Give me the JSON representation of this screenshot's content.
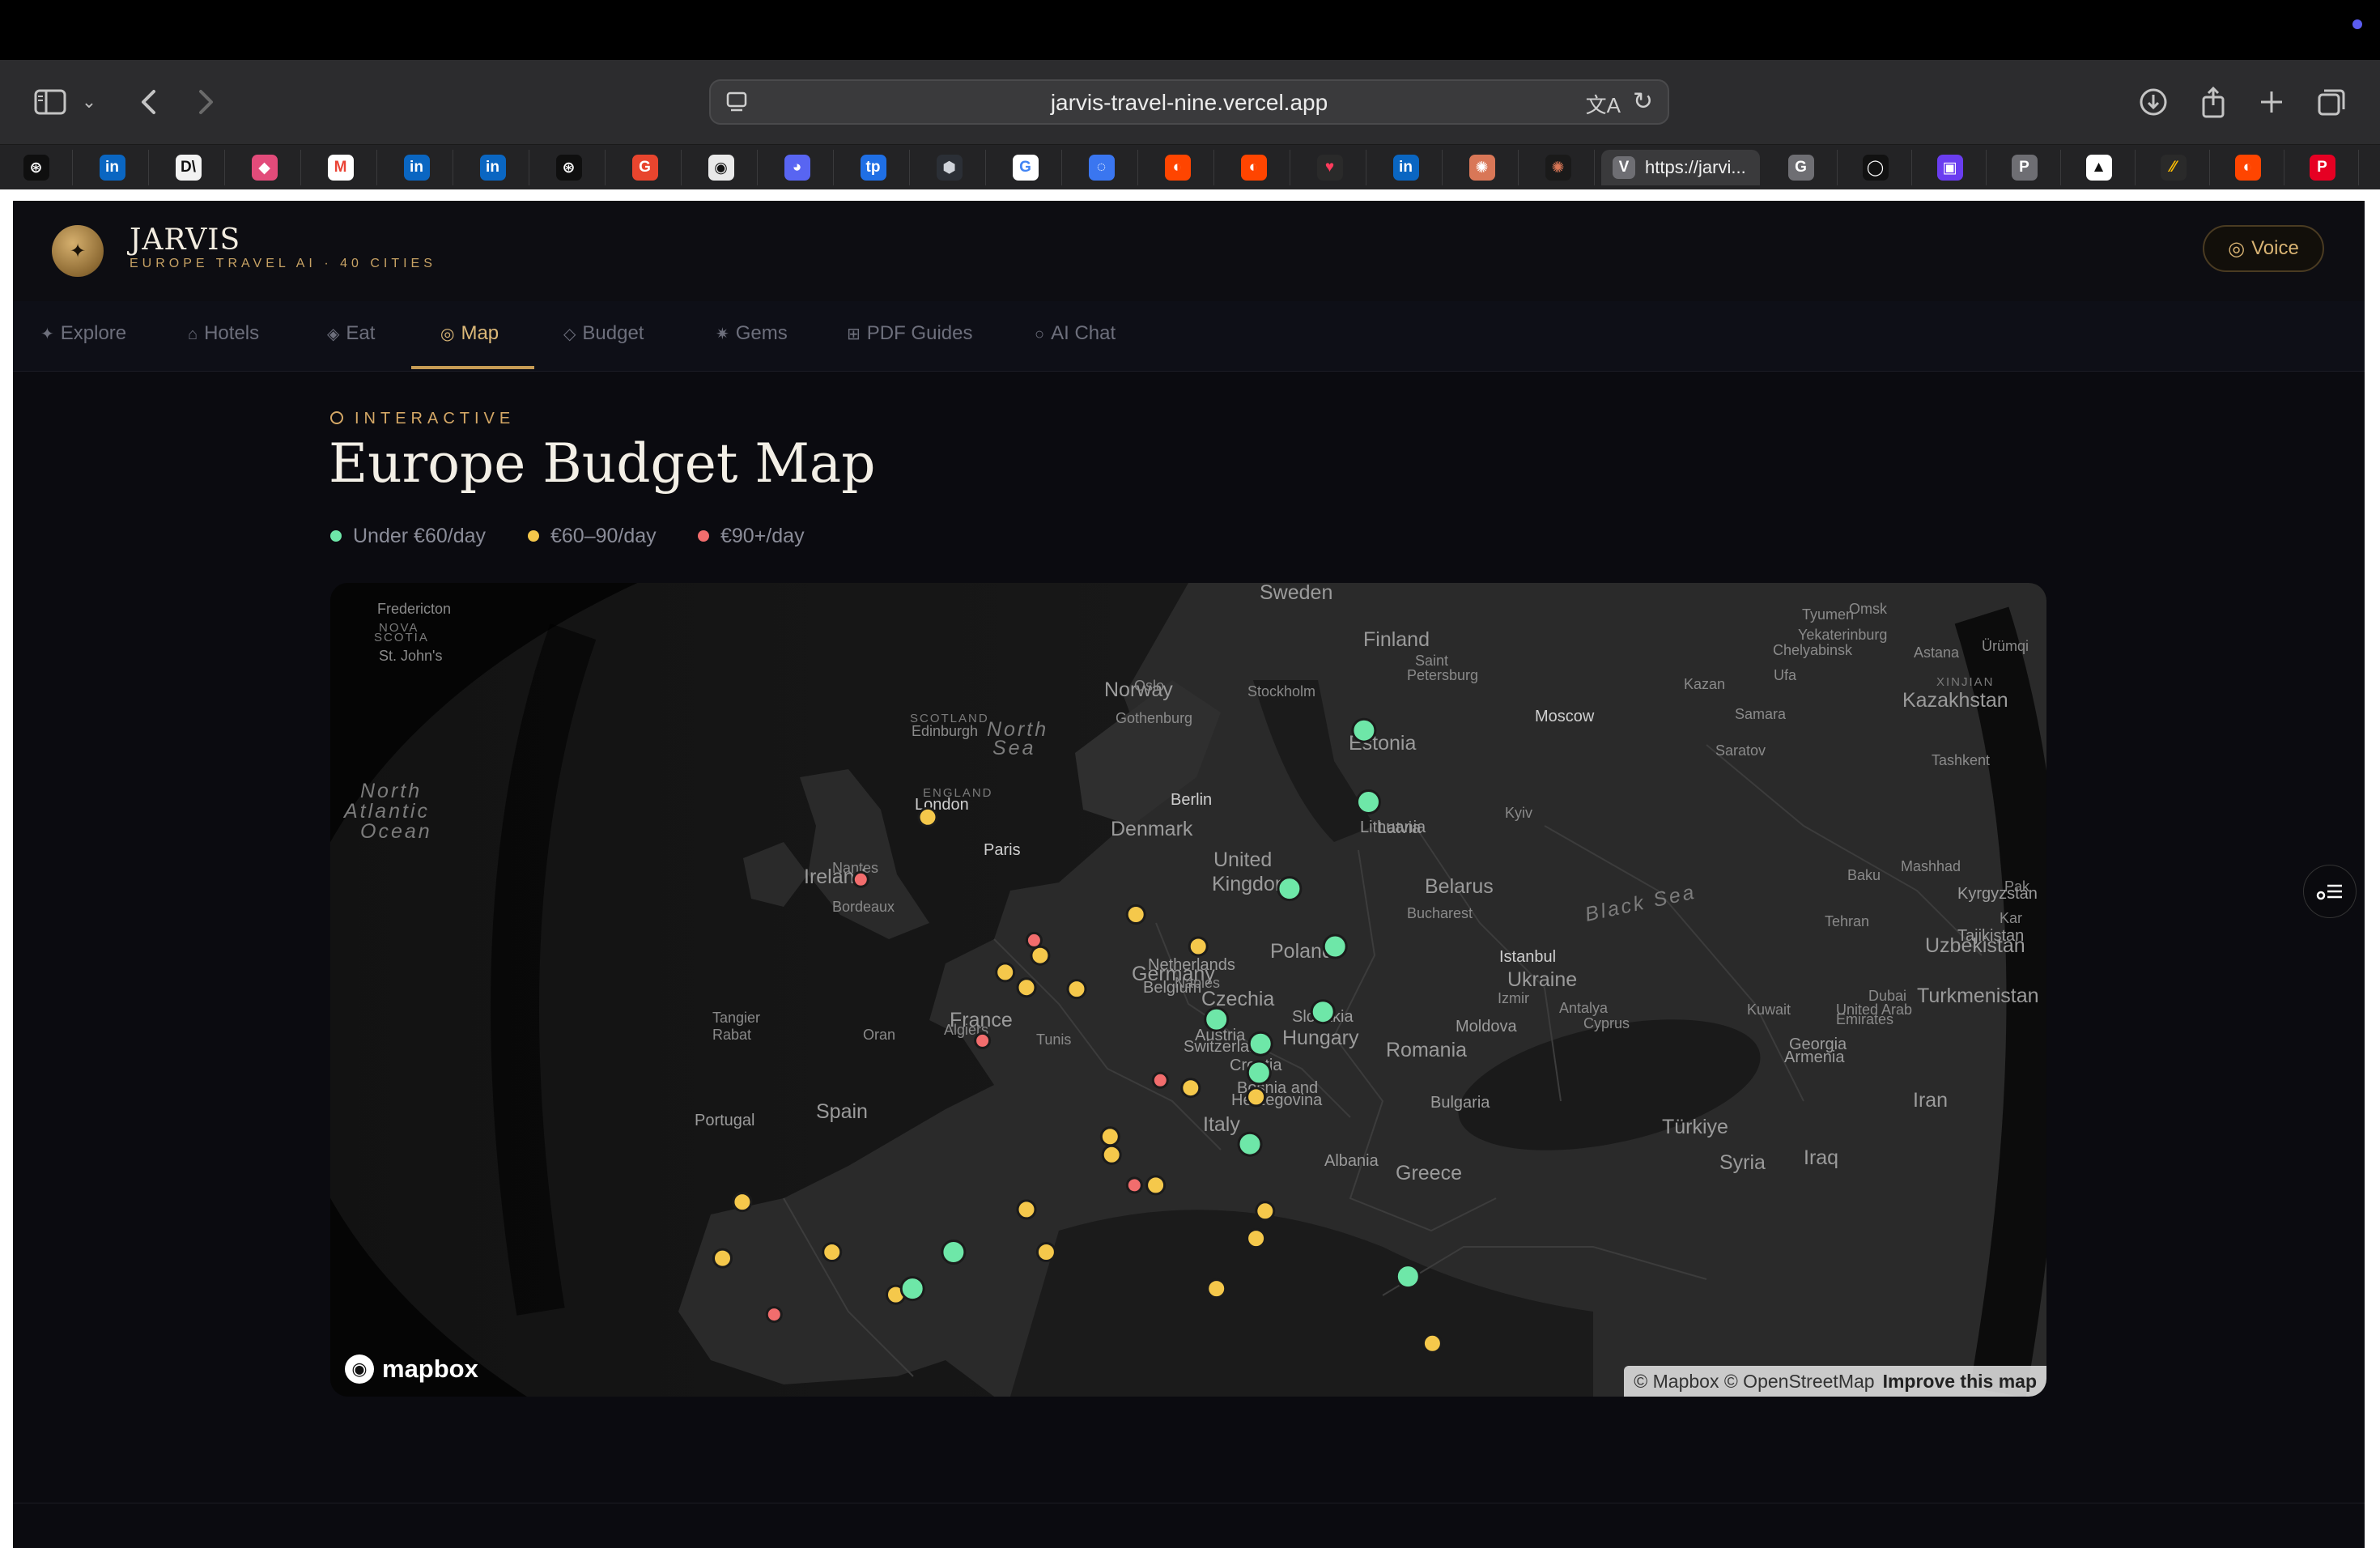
{
  "browser": {
    "url": "jarvis-travel-nine.vercel.app",
    "active_tab_title": "https://jarvi...",
    "tabs": [
      {
        "icon": "chatgpt-icon",
        "glyph": "⊛",
        "color": "#ffffff",
        "bg": "#0f0f0f"
      },
      {
        "icon": "linkedin-icon",
        "glyph": "in",
        "color": "#ffffff",
        "bg": "#0a66c2"
      },
      {
        "icon": "dl-icon",
        "glyph": "D\\",
        "color": "#111111",
        "bg": "#f2f2f2"
      },
      {
        "icon": "tag-icon",
        "glyph": "◆",
        "color": "#ffffff",
        "bg": "#e24b7a"
      },
      {
        "icon": "gmail-icon",
        "glyph": "M",
        "color": "#ea4335",
        "bg": "#ffffff"
      },
      {
        "icon": "linkedin-icon",
        "glyph": "in",
        "color": "#ffffff",
        "bg": "#0a66c2"
      },
      {
        "icon": "linkedin-icon",
        "glyph": "in",
        "color": "#ffffff",
        "bg": "#0a66c2"
      },
      {
        "icon": "chatgpt-icon",
        "glyph": "⊛",
        "color": "#ffffff",
        "bg": "#0f0f0f"
      },
      {
        "icon": "g-red-icon",
        "glyph": "G",
        "color": "#ffffff",
        "bg": "#e8452e"
      },
      {
        "icon": "ghost-icon",
        "glyph": "◉",
        "color": "#111111",
        "bg": "#e9e9e9"
      },
      {
        "icon": "discord-icon",
        "glyph": "◕",
        "color": "#ffffff",
        "bg": "#5865f2"
      },
      {
        "icon": "tp-icon",
        "glyph": "tp",
        "color": "#ffffff",
        "bg": "#1f6fe5"
      },
      {
        "icon": "cube-icon",
        "glyph": "⬢",
        "color": "#cfd3da",
        "bg": "#2b2f36"
      },
      {
        "icon": "google-icon",
        "glyph": "G",
        "color": "#4285f4",
        "bg": "#ffffff"
      },
      {
        "icon": "signal-icon",
        "glyph": "◌",
        "color": "#ffffff",
        "bg": "#3a76f0"
      },
      {
        "icon": "reddit-icon",
        "glyph": "◐",
        "color": "#ffffff",
        "bg": "#ff4500"
      },
      {
        "icon": "reddit-icon",
        "glyph": "◐",
        "color": "#ffffff",
        "bg": "#ff4500"
      },
      {
        "icon": "heart-icon",
        "glyph": "♥",
        "color": "#ff3b5c",
        "bg": "#2a2a2a"
      },
      {
        "icon": "linkedin-icon",
        "glyph": "in",
        "color": "#ffffff",
        "bg": "#0a66c2"
      },
      {
        "icon": "claude-icon",
        "glyph": "✺",
        "color": "#ffffff",
        "bg": "#d97757"
      },
      {
        "icon": "claude-icon",
        "glyph": "✺",
        "color": "#d97757",
        "bg": "#1a1a1a"
      }
    ],
    "tabs_after": [
      {
        "icon": "g-grey-icon",
        "glyph": "G",
        "color": "#ffffff",
        "bg": "#6e6e73"
      },
      {
        "icon": "github-icon",
        "glyph": "◯",
        "color": "#ffffff",
        "bg": "#111111"
      },
      {
        "icon": "panel-icon",
        "glyph": "▣",
        "color": "#ffffff",
        "bg": "#6a3df0"
      },
      {
        "icon": "p-grey-icon",
        "glyph": "P",
        "color": "#ffffff",
        "bg": "#6e6e73"
      },
      {
        "icon": "triangle-icon",
        "glyph": "▲",
        "color": "#111111",
        "bg": "#ffffff"
      },
      {
        "icon": "ads-icon",
        "glyph": "⁄⁄",
        "color": "#fbbc04",
        "bg": "#2a2a2a"
      },
      {
        "icon": "reddit-icon",
        "glyph": "◐",
        "color": "#ffffff",
        "bg": "#ff4500"
      },
      {
        "icon": "p-red-icon",
        "glyph": "P",
        "color": "#ffffff",
        "bg": "#e60023"
      }
    ]
  },
  "app": {
    "brand_title": "JARVIS",
    "brand_subtitle": "EUROPE TRAVEL AI · 40 CITIES",
    "voice_label": "Voice",
    "nav": [
      {
        "icon": "sparkle-icon",
        "glyph": "✦",
        "label": "Explore"
      },
      {
        "icon": "home-icon",
        "glyph": "⌂",
        "label": "Hotels"
      },
      {
        "icon": "diamond-icon",
        "glyph": "◈",
        "label": "Eat"
      },
      {
        "icon": "map-icon",
        "glyph": "◎",
        "label": "Map",
        "active": true
      },
      {
        "icon": "budget-icon",
        "glyph": "◇",
        "label": "Budget"
      },
      {
        "icon": "gem-icon",
        "glyph": "✷",
        "label": "Gems"
      },
      {
        "icon": "grid-icon",
        "glyph": "⊞",
        "label": "PDF Guides"
      },
      {
        "icon": "chat-icon",
        "glyph": "○",
        "label": "AI Chat"
      }
    ],
    "kicker": "INTERACTIVE",
    "title": "Europe Budget Map",
    "legend": [
      {
        "label": "Under €60/day",
        "color": "#6ee7a8"
      },
      {
        "label": "€60–90/day",
        "color": "#f5c84b"
      },
      {
        "label": "€90+/day",
        "color": "#f26d6d"
      }
    ]
  },
  "map": {
    "attribution_text": "© Mapbox © OpenStreetMap",
    "attribution_link": "Improve this map",
    "logo_text": "mapbox",
    "labels_large": [
      {
        "t": "Sweden"
      },
      {
        "t": "Finland"
      },
      {
        "t": "Norway"
      },
      {
        "t": "Estonia"
      },
      {
        "t": "Denmark"
      },
      {
        "t": "United"
      },
      {
        "t": "Kingdom"
      },
      {
        "t": "Ireland"
      },
      {
        "t": "Belarus"
      },
      {
        "t": "Poland"
      },
      {
        "t": "Germany"
      },
      {
        "t": "France"
      },
      {
        "t": "Ukraine"
      },
      {
        "t": "Czechia"
      },
      {
        "t": "Hungary"
      },
      {
        "t": "Romania"
      },
      {
        "t": "Spain"
      },
      {
        "t": "Italy"
      },
      {
        "t": "Greece"
      },
      {
        "t": "Türkiye"
      },
      {
        "t": "Kazakhstan"
      },
      {
        "t": "Turkmenistan"
      },
      {
        "t": "Uzbekistan"
      },
      {
        "t": "Iran"
      },
      {
        "t": "Syria"
      },
      {
        "t": "Iraq"
      },
      {
        "t": "Lithuania"
      },
      {
        "t": "Netherlands"
      },
      {
        "t": "Belgium"
      },
      {
        "t": "Slovakia"
      },
      {
        "t": "Austria"
      },
      {
        "t": "Switzerland"
      },
      {
        "t": "Croatia"
      },
      {
        "t": "Bulgaria"
      },
      {
        "t": "Moldova"
      },
      {
        "t": "Portugal"
      },
      {
        "t": "Bosnia and"
      },
      {
        "t": "Herzegovina"
      },
      {
        "t": "Albania"
      },
      {
        "t": "Georgia"
      },
      {
        "t": "Armenia"
      },
      {
        "t": "Latvia"
      },
      {
        "t": "Kyrgyzstan"
      },
      {
        "t": "Tajikistan"
      }
    ],
    "labels_small": [
      {
        "t": "Oslo"
      },
      {
        "t": "Stockholm"
      },
      {
        "t": "Saint"
      },
      {
        "t": "Petersburg"
      },
      {
        "t": "Gothenburg"
      },
      {
        "t": "Moscow"
      },
      {
        "t": "Kazan"
      },
      {
        "t": "Samara"
      },
      {
        "t": "Saratov"
      },
      {
        "t": "Ufa"
      },
      {
        "t": "Yekaterinburg"
      },
      {
        "t": "Chelyabinsk"
      },
      {
        "t": "Tyumen"
      },
      {
        "t": "Omsk"
      },
      {
        "t": "Astana"
      },
      {
        "t": "Ürümqi"
      },
      {
        "t": "Tashkent"
      },
      {
        "t": "London"
      },
      {
        "t": "Edinburgh"
      },
      {
        "t": "Paris"
      },
      {
        "t": "Berlin"
      },
      {
        "t": "Kyiv"
      },
      {
        "t": "Nantes"
      },
      {
        "t": "Bordeaux"
      },
      {
        "t": "Bucharest"
      },
      {
        "t": "Istanbul"
      },
      {
        "t": "Baku"
      },
      {
        "t": "Mashhad"
      },
      {
        "t": "Tehran"
      },
      {
        "t": "Izmir"
      },
      {
        "t": "Antalya"
      },
      {
        "t": "Naples"
      },
      {
        "t": "Dubai"
      },
      {
        "t": "Kuwait"
      },
      {
        "t": "United Arab"
      },
      {
        "t": "Emirates"
      },
      {
        "t": "Tangier"
      },
      {
        "t": "Rabat"
      },
      {
        "t": "Oran"
      },
      {
        "t": "Algiers"
      },
      {
        "t": "Tunis"
      },
      {
        "t": "St. John's"
      },
      {
        "t": "Fredericton"
      },
      {
        "t": "Cyprus"
      },
      {
        "t": "Pak"
      },
      {
        "t": "Kar"
      }
    ],
    "labels_caps": [
      {
        "t": "SCOTLAND"
      },
      {
        "t": "ENGLAND"
      },
      {
        "t": "NOVA"
      },
      {
        "t": "SCOTIA"
      },
      {
        "t": "XINJIAN"
      }
    ],
    "labels_water": [
      {
        "t": "North"
      },
      {
        "t": "Sea"
      },
      {
        "t": "North"
      },
      {
        "t": "Atlantic"
      },
      {
        "t": "Ocean"
      },
      {
        "t": "Black Sea"
      }
    ],
    "markers": [
      {
        "tier": "green"
      },
      {
        "tier": "green"
      },
      {
        "tier": "yellow"
      },
      {
        "tier": "red"
      },
      {
        "tier": "green"
      },
      {
        "tier": "yellow"
      },
      {
        "tier": "yellow"
      },
      {
        "tier": "green"
      },
      {
        "tier": "red"
      },
      {
        "tier": "yellow"
      },
      {
        "tier": "yellow"
      },
      {
        "tier": "yellow"
      },
      {
        "tier": "yellow"
      },
      {
        "tier": "green"
      },
      {
        "tier": "green"
      },
      {
        "tier": "green"
      },
      {
        "tier": "red"
      },
      {
        "tier": "green"
      },
      {
        "tier": "yellow"
      },
      {
        "tier": "red"
      },
      {
        "tier": "yellow"
      },
      {
        "tier": "yellow"
      },
      {
        "tier": "green"
      },
      {
        "tier": "yellow"
      },
      {
        "tier": "red"
      },
      {
        "tier": "yellow"
      },
      {
        "tier": "yellow"
      },
      {
        "tier": "yellow"
      },
      {
        "tier": "yellow"
      },
      {
        "tier": "yellow"
      },
      {
        "tier": "yellow"
      },
      {
        "tier": "yellow"
      },
      {
        "tier": "yellow"
      },
      {
        "tier": "red"
      },
      {
        "tier": "yellow"
      },
      {
        "tier": "green"
      },
      {
        "tier": "green"
      },
      {
        "tier": "green"
      },
      {
        "tier": "yellow"
      },
      {
        "tier": "yellow"
      }
    ]
  }
}
